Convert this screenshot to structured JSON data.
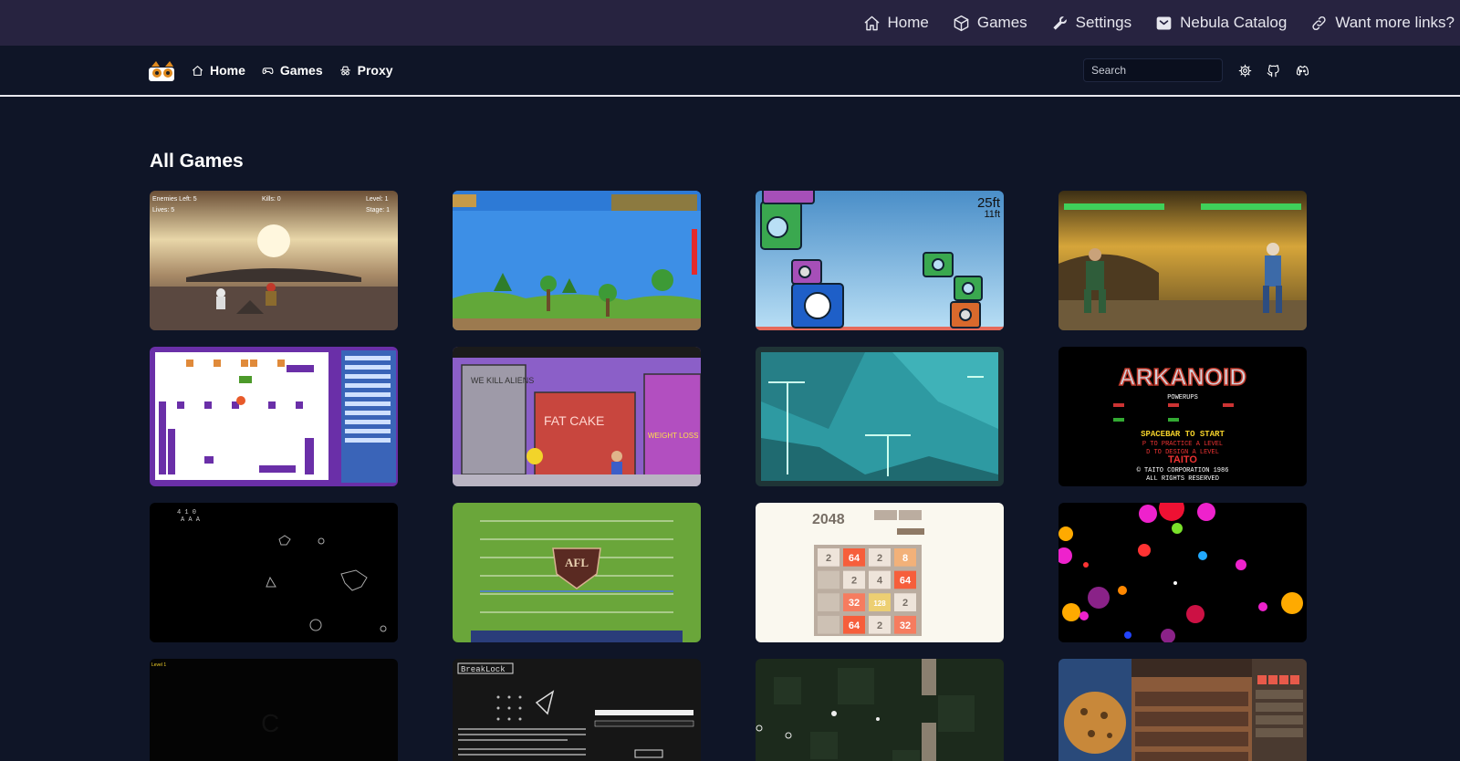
{
  "topnav": {
    "items": [
      {
        "label": "Home",
        "icon": "home-icon"
      },
      {
        "label": "Games",
        "icon": "cube-icon"
      },
      {
        "label": "Settings",
        "icon": "wrench-icon"
      },
      {
        "label": "Nebula Catalog",
        "icon": "inbox-icon"
      },
      {
        "label": "Want more links?",
        "icon": "link-icon"
      }
    ]
  },
  "navbar": {
    "links": [
      {
        "label": "Home",
        "icon": "home-icon"
      },
      {
        "label": "Games",
        "icon": "gamepad-icon"
      },
      {
        "label": "Proxy",
        "icon": "spy-icon"
      }
    ],
    "search_placeholder": "Search",
    "icons": [
      "gear-icon",
      "github-icon",
      "discord-icon"
    ]
  },
  "main": {
    "heading": "All Games"
  },
  "games": {
    "g1": {
      "hud_a": "Enemies Left: 5",
      "hud_b": "Kills: 0",
      "hud_c": "Level: 1",
      "hud_d": "Lives: 5",
      "hud_e": "Stage: 1"
    },
    "g3": {
      "ft_a": "25ft",
      "ft_b": "11ft"
    },
    "g6": {
      "sign_a": "WE KILL ALIENS",
      "sign_b": "FAT CAKE",
      "sign_c": "WEIGHT LOSS"
    },
    "g8": {
      "line_a": "POWERUPS",
      "line_b": "SPACEBAR TO START",
      "line_c": "P TO PRACTICE A LEVEL",
      "line_d": "D TO DESIGN A LEVEL",
      "line_e": "TAITO",
      "line_f": "© TAITO CORPORATION 1986",
      "line_g": "ALL RIGHTS RESERVED"
    },
    "g11": {
      "title": "2048",
      "tiles": [
        "2",
        "64",
        "2",
        "8",
        "",
        "2",
        "4",
        "64",
        "",
        "32",
        "128",
        "2",
        "",
        "64",
        "2",
        "32"
      ]
    },
    "g14": {
      "title": "BreakLock"
    }
  },
  "colors": {
    "topbar": "#272340",
    "page_bg": "#0f1527"
  }
}
